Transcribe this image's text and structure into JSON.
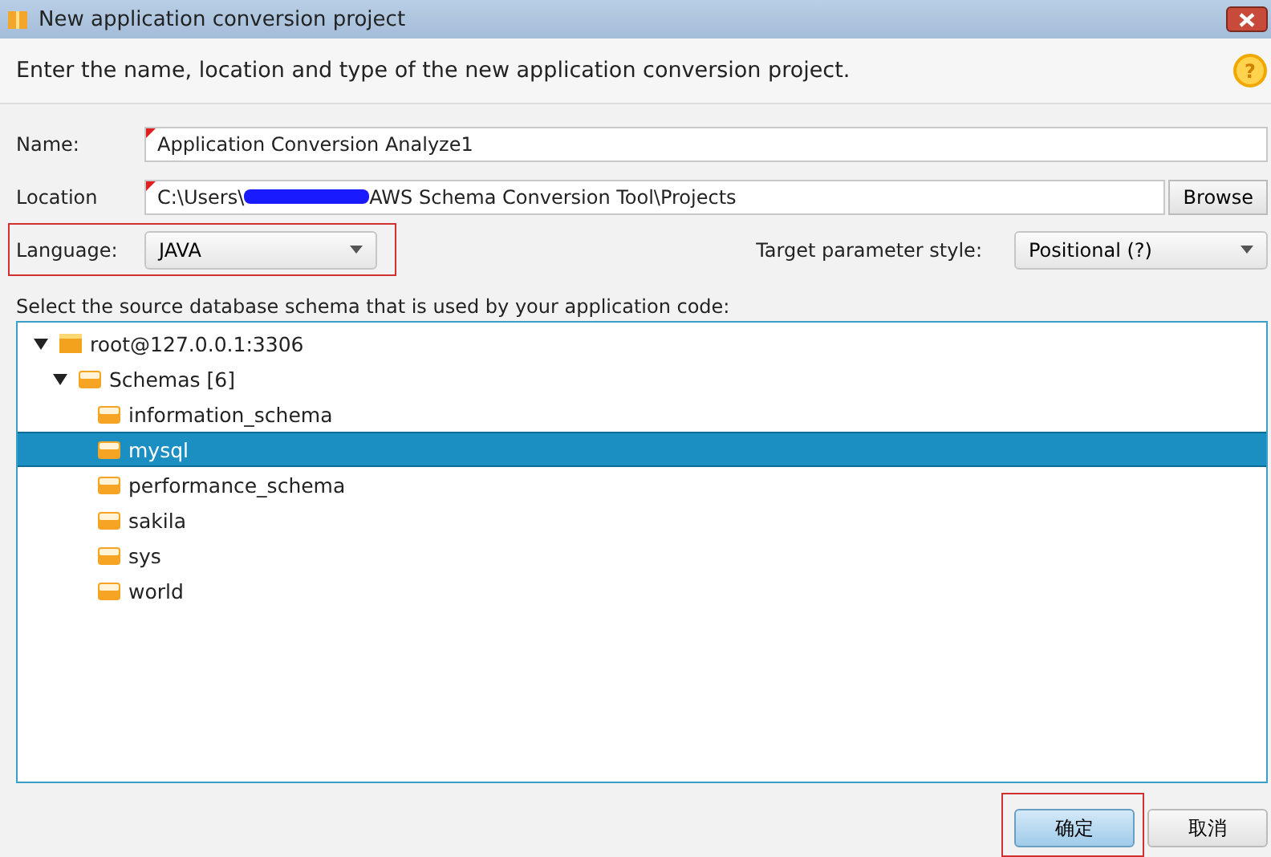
{
  "window": {
    "title": "New application conversion project"
  },
  "header": {
    "text": "Enter the name, location and type of the new application conversion project.",
    "help": "?"
  },
  "name": {
    "label": "Name:",
    "value": "Application Conversion Analyze1",
    "required": true
  },
  "location": {
    "label": "Location",
    "value_start": "C:\\Users\\",
    "value_end": "AWS Schema Conversion Tool\\Projects",
    "required": true,
    "browse": "Browse"
  },
  "language": {
    "label": "Language:",
    "value": "JAVA",
    "highlighted": true
  },
  "target_style": {
    "label": "Target parameter style:",
    "value": "Positional (?)"
  },
  "tree_label": "Select the source database schema that is used by your application code:",
  "tree": [
    {
      "label": "root@127.0.0.1:3306",
      "kind": "server",
      "expanded": true,
      "selected": false,
      "children": [
        {
          "label": "Schemas [6]",
          "kind": "folder",
          "expanded": true,
          "selected": false,
          "children": [
            {
              "label": "information_schema",
              "kind": "schema",
              "selected": false
            },
            {
              "label": "mysql",
              "kind": "schema",
              "selected": true
            },
            {
              "label": "performance_schema",
              "kind": "schema",
              "selected": false
            },
            {
              "label": "sakila",
              "kind": "schema",
              "selected": false
            },
            {
              "label": "sys",
              "kind": "schema",
              "selected": false
            },
            {
              "label": "world",
              "kind": "schema",
              "selected": false
            }
          ]
        }
      ]
    }
  ],
  "buttons": [
    {
      "label": "确定",
      "kind": "primary",
      "highlighted": true
    },
    {
      "label": "取消",
      "kind": "normal",
      "highlighted": false
    }
  ]
}
